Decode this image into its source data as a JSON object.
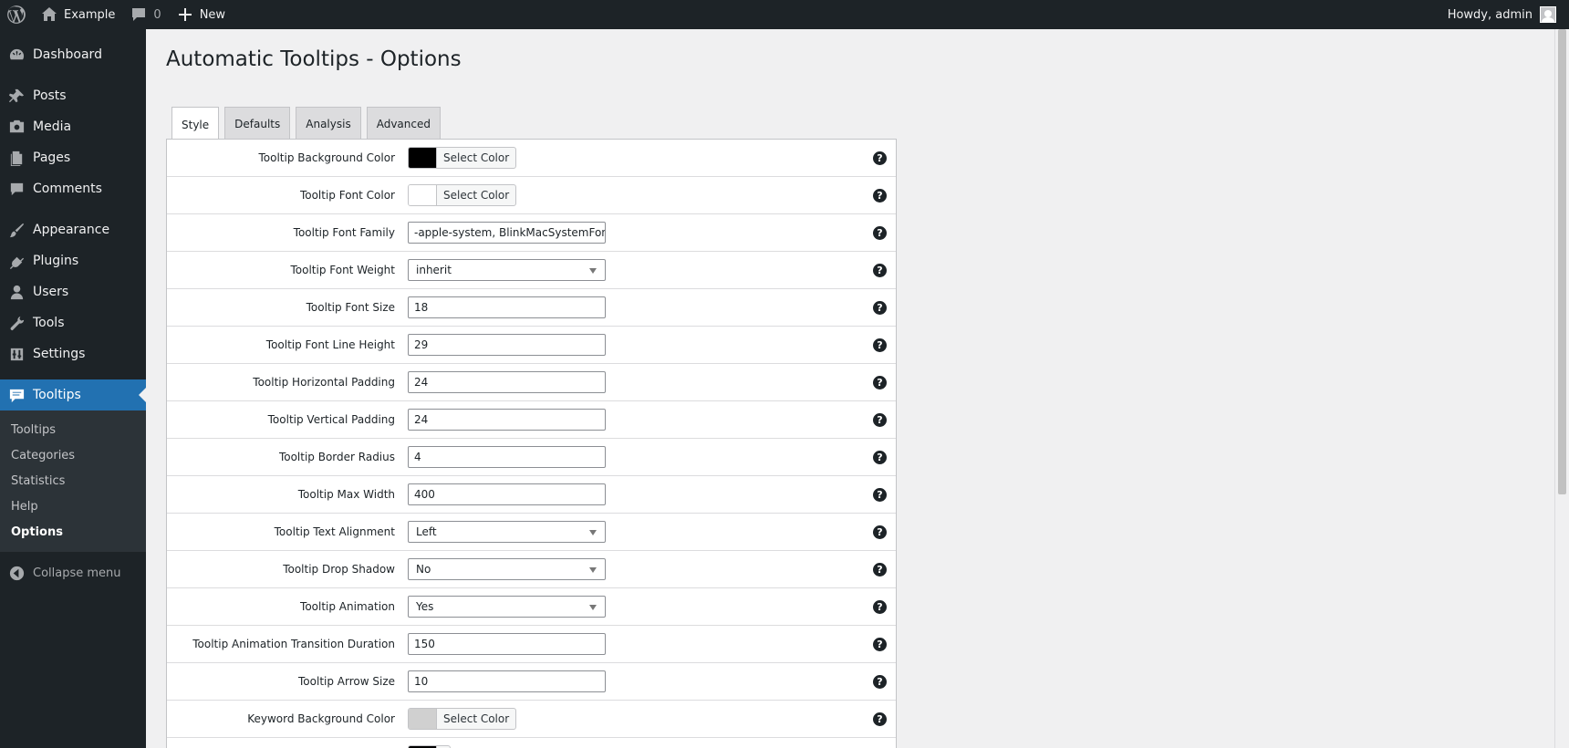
{
  "adminbar": {
    "site_name": "Example",
    "comments_count": "0",
    "new_label": "New",
    "howdy": "Howdy, admin"
  },
  "sidebar": {
    "items": [
      {
        "label": "Dashboard",
        "icon": "dashboard-icon"
      },
      {
        "label": "Posts",
        "icon": "pin-icon"
      },
      {
        "label": "Media",
        "icon": "media-icon"
      },
      {
        "label": "Pages",
        "icon": "pages-icon"
      },
      {
        "label": "Comments",
        "icon": "comment-icon"
      },
      {
        "label": "Appearance",
        "icon": "brush-icon"
      },
      {
        "label": "Plugins",
        "icon": "plugin-icon"
      },
      {
        "label": "Users",
        "icon": "user-icon"
      },
      {
        "label": "Tools",
        "icon": "wrench-icon"
      },
      {
        "label": "Settings",
        "icon": "settings-icon"
      },
      {
        "label": "Tooltips",
        "icon": "tooltip-icon"
      }
    ],
    "submenu": [
      "Tooltips",
      "Categories",
      "Statistics",
      "Help",
      "Options"
    ],
    "collapse_label": "Collapse menu"
  },
  "page": {
    "title": "Automatic Tooltips - Options"
  },
  "tabs": [
    "Style",
    "Defaults",
    "Analysis",
    "Advanced"
  ],
  "colors": {
    "accent": "#2271b1",
    "adminbar_bg": "#1d2327",
    "tooltip_bg_swatch": "#000000",
    "tooltip_font_swatch": "#ffffff",
    "keyword_bg_swatch": "#d0d0d0",
    "next_swatch": "#000000"
  },
  "options": [
    {
      "label": "Tooltip Background Color",
      "type": "color",
      "button": "Select Color"
    },
    {
      "label": "Tooltip Font Color",
      "type": "color",
      "button": "Select Color"
    },
    {
      "label": "Tooltip Font Family",
      "type": "text",
      "value": "-apple-system, BlinkMacSystemFont, 'S"
    },
    {
      "label": "Tooltip Font Weight",
      "type": "select",
      "value": "inherit"
    },
    {
      "label": "Tooltip Font Size",
      "type": "text",
      "value": "18"
    },
    {
      "label": "Tooltip Font Line Height",
      "type": "text",
      "value": "29"
    },
    {
      "label": "Tooltip Horizontal Padding",
      "type": "text",
      "value": "24"
    },
    {
      "label": "Tooltip Vertical Padding",
      "type": "text",
      "value": "24"
    },
    {
      "label": "Tooltip Border Radius",
      "type": "text",
      "value": "4"
    },
    {
      "label": "Tooltip Max Width",
      "type": "text",
      "value": "400"
    },
    {
      "label": "Tooltip Text Alignment",
      "type": "select",
      "value": "Left"
    },
    {
      "label": "Tooltip Drop Shadow",
      "type": "select",
      "value": "No"
    },
    {
      "label": "Tooltip Animation",
      "type": "select",
      "value": "Yes"
    },
    {
      "label": "Tooltip Animation Transition Duration",
      "type": "text",
      "value": "150"
    },
    {
      "label": "Tooltip Arrow Size",
      "type": "text",
      "value": "10"
    },
    {
      "label": "Keyword Background Color",
      "type": "color",
      "button": "Select Color"
    }
  ]
}
